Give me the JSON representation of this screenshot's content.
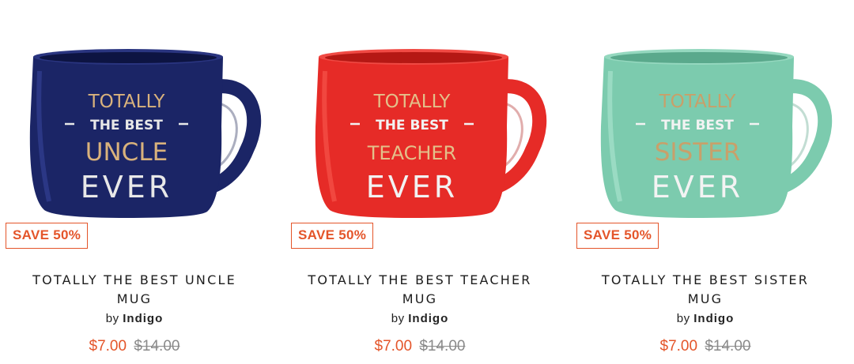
{
  "products": [
    {
      "name": "TOTALLY THE BEST UNCLE MUG",
      "title_line1": "TOTALLY THE BEST UNCLE",
      "title_line2": "MUG",
      "by": "by",
      "brand": "Indigo",
      "badge": "SAVE 50%",
      "sale_price": "$7.00",
      "original_price": "$14.00",
      "mug_color": "#1b2566",
      "mug_text": {
        "l1": "TOTALLY",
        "l2": "THE BEST",
        "l3": "UNCLE",
        "l4": "EVER"
      }
    },
    {
      "name": "TOTALLY THE BEST TEACHER MUG",
      "title_line1": "TOTALLY THE BEST TEACHER",
      "title_line2": "MUG",
      "by": "by",
      "brand": "Indigo",
      "badge": "SAVE 50%",
      "sale_price": "$7.00",
      "original_price": "$14.00",
      "mug_color": "#e62b27",
      "mug_text": {
        "l1": "TOTALLY",
        "l2": "THE BEST",
        "l3": "TEACHER",
        "l4": "EVER"
      }
    },
    {
      "name": "TOTALLY THE BEST SISTER MUG",
      "title_line1": "TOTALLY THE BEST SISTER",
      "title_line2": "MUG",
      "by": "by",
      "brand": "Indigo",
      "badge": "SAVE 50%",
      "sale_price": "$7.00",
      "original_price": "$14.00",
      "mug_color": "#7ccbae",
      "mug_text": {
        "l1": "TOTALLY",
        "l2": "THE BEST",
        "l3": "SISTER",
        "l4": "EVER"
      }
    }
  ],
  "colors": {
    "accent": "#e4552a",
    "gold": "#d9b27c",
    "silver": "#e8e8e8",
    "strike": "#8a8a8a"
  }
}
